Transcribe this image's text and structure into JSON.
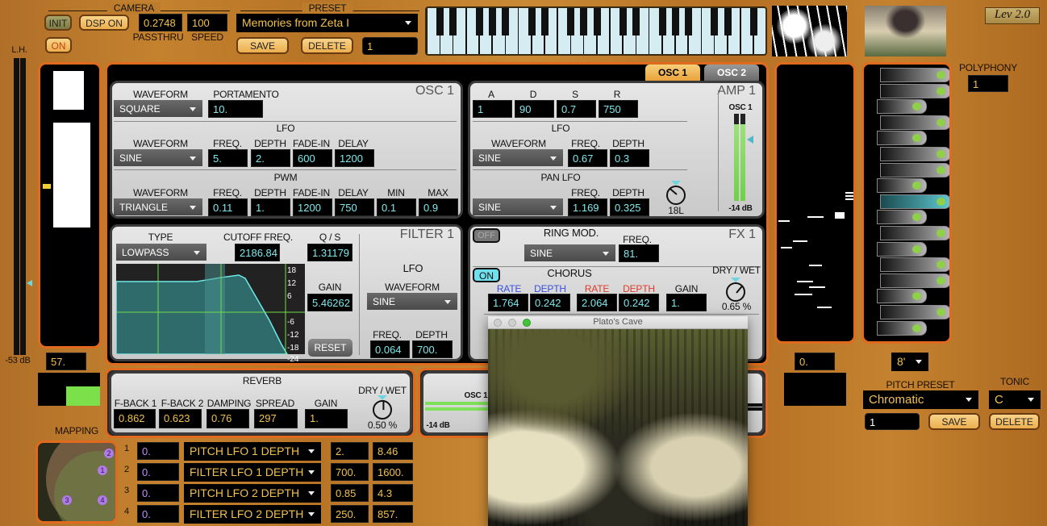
{
  "camera": {
    "label": "CAMERA",
    "init": "INIT",
    "dsp_on": "DSP ON",
    "on": "ON",
    "passthru_value": "0.2748",
    "passthru_label": "PASSTHRU",
    "speed_value": "100",
    "speed_label": "SPEED"
  },
  "preset": {
    "label": "PRESET",
    "selected": "Memories from Zeta I",
    "save": "SAVE",
    "delete": "DELETE",
    "number": "1"
  },
  "version": "Lev 2.0",
  "left": {
    "lh_label": "L.H.",
    "meter_db": "-53 dB",
    "value": "57."
  },
  "tabs": [
    {
      "label": "OSC 1",
      "active": true
    },
    {
      "label": "OSC 2",
      "active": false
    }
  ],
  "osc1": {
    "title": "OSC 1",
    "waveform_label": "WAVEFORM",
    "waveform": "SQUARE",
    "portamento_label": "PORTAMENTO",
    "portamento": "10.",
    "lfo": {
      "title": "LFO",
      "waveform_label": "WAVEFORM",
      "waveform": "SINE",
      "freq_label": "FREQ.",
      "freq": "5.",
      "depth_label": "DEPTH",
      "depth": "2.",
      "fadein_label": "FADE-IN",
      "fadein": "600",
      "delay_label": "DELAY",
      "delay": "1200"
    },
    "pwm": {
      "title": "PWM",
      "waveform_label": "WAVEFORM",
      "waveform": "TRIANGLE",
      "freq_label": "FREQ.",
      "freq": "0.11",
      "depth_label": "DEPTH",
      "depth": "1.",
      "fadein_label": "FADE-IN",
      "fadein": "1200",
      "delay_label": "DELAY",
      "delay": "750",
      "min_label": "MIN",
      "min": "0.1",
      "max_label": "MAX",
      "max": "0.9"
    }
  },
  "amp1": {
    "title": "AMP 1",
    "a_label": "A",
    "a": "1",
    "d_label": "D",
    "d": "90",
    "s_label": "S",
    "s": "0.7",
    "r_label": "R",
    "r": "750",
    "lfo": {
      "title": "LFO",
      "waveform_label": "WAVEFORM",
      "waveform": "SINE",
      "freq_label": "FREQ.",
      "freq": "0.67",
      "depth_label": "DEPTH",
      "depth": "0.3"
    },
    "pan_lfo": {
      "title": "PAN LFO",
      "waveform": "SINE",
      "freq_label": "FREQ.",
      "freq": "1.169",
      "depth_label": "DEPTH",
      "depth": "0.325",
      "pan": "18L"
    },
    "meter": {
      "label": "OSC 1",
      "db": "-14 dB"
    }
  },
  "filter1": {
    "title": "FILTER 1",
    "type_label": "TYPE",
    "type": "LOWPASS",
    "cutoff_label": "CUTOFF FREQ.",
    "cutoff": "2186.84",
    "q_label": "Q / S",
    "q": "1.31179",
    "gain_label": "GAIN",
    "gain": "5.46262",
    "reset": "RESET",
    "graph_ticks": [
      "18",
      "12",
      "6",
      "-6",
      "-12",
      "-18",
      "-24"
    ],
    "lfo": {
      "title": "LFO",
      "waveform_label": "WAVEFORM",
      "waveform": "SINE",
      "freq_label": "FREQ.",
      "freq": "0.064",
      "depth_label": "DEPTH",
      "depth": "700."
    }
  },
  "fx1": {
    "title": "FX 1",
    "ring_toggle": "OFF",
    "ring_title": "RING MOD.",
    "ring_waveform": "SINE",
    "ring_freq_label": "FREQ.",
    "ring_freq": "81.",
    "chorus_toggle": "ON",
    "chorus_title": "CHORUS",
    "drywet_label": "DRY / WET",
    "drywet": "0.65 %",
    "rate1_label": "RATE",
    "rate1": "1.764",
    "depth1_label": "DEPTH",
    "depth1": "0.242",
    "rate2_label": "RATE",
    "rate2": "2.064",
    "depth2_label": "DEPTH",
    "depth2": "0.242",
    "gain_label": "GAIN",
    "gain": "1.",
    "colors": {
      "voice1": "#3a4fe0",
      "voice2": "#e03a2a"
    }
  },
  "reverb": {
    "title": "REVERB",
    "fback1_label": "F-BACK 1",
    "fback1": "0.862",
    "fback2_label": "F-BACK 2",
    "fback2": "0.623",
    "damping_label": "DAMPING",
    "damping": "0.76",
    "spread_label": "SPREAD",
    "spread": "297",
    "gain_label": "GAIN",
    "gain": "1.",
    "drywet_label": "DRY / WET",
    "drywet": "0.50 %"
  },
  "mixer": {
    "label": "OSC 1",
    "db": "-14 dB"
  },
  "mapping": {
    "label": "MAPPING",
    "pad_points": [
      "1",
      "2",
      "3",
      "4"
    ],
    "rows": [
      {
        "index": "1",
        "value": "0.",
        "target": "PITCH LFO 1 DEPTH",
        "min": "2.",
        "max": "8.46"
      },
      {
        "index": "2",
        "value": "0.",
        "target": "FILTER LFO 1 DEPTH",
        "min": "700.",
        "max": "1600."
      },
      {
        "index": "3",
        "value": "0.",
        "target": "PITCH LFO 2 DEPTH",
        "min": "0.85",
        "max": "4.3"
      },
      {
        "index": "4",
        "value": "0.",
        "target": "FILTER LFO 2 DEPTH",
        "min": "250.",
        "max": "857."
      }
    ]
  },
  "window": {
    "title": "Plato's Cave"
  },
  "right": {
    "value": "0.",
    "polyphony_label": "POLYPHONY",
    "polyphony": "1",
    "octave": "8'",
    "pitch_preset_label": "PITCH PRESET",
    "pitch_preset": "Chromatic",
    "tonic_label": "TONIC",
    "tonic": "C",
    "preset_number": "1",
    "save": "SAVE",
    "delete": "DELETE"
  }
}
